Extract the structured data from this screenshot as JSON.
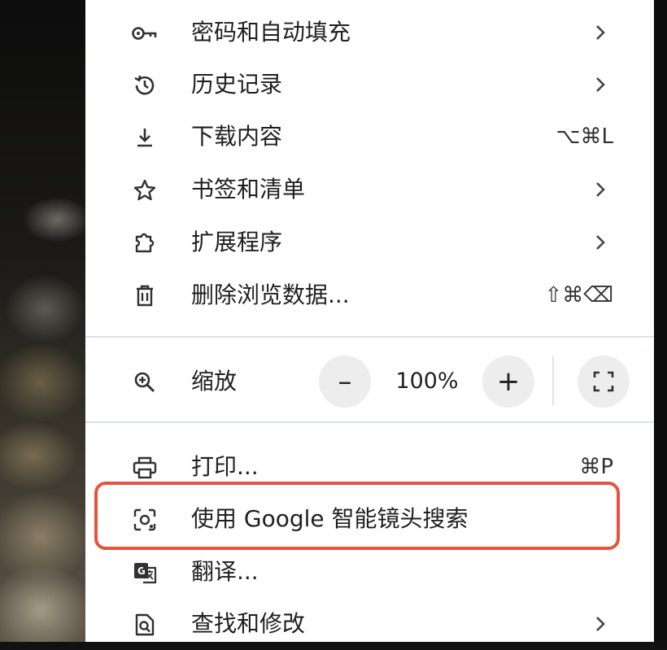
{
  "menu": {
    "items": [
      {
        "label": "密码和自动填充",
        "icon": "key-icon",
        "right": "",
        "chevron": true
      },
      {
        "label": "历史记录",
        "icon": "history-icon",
        "right": "",
        "chevron": true
      },
      {
        "label": "下载内容",
        "icon": "download-icon",
        "right": "⌥⌘L",
        "chevron": false
      },
      {
        "label": "书签和清单",
        "icon": "star-icon",
        "right": "",
        "chevron": true
      },
      {
        "label": "扩展程序",
        "icon": "puzzle-icon",
        "right": "",
        "chevron": true
      },
      {
        "label": "删除浏览数据...",
        "icon": "trash-icon",
        "right": "⇧⌘⌫",
        "chevron": false
      }
    ],
    "zoom": {
      "label": "缩放",
      "icon": "zoom-in-icon",
      "minus": "–",
      "value": "100%",
      "plus": "+",
      "fullscreen_icon": "fullscreen-icon"
    },
    "items2": [
      {
        "label": "打印...",
        "icon": "printer-icon",
        "right": "⌘P",
        "chevron": false
      },
      {
        "label": "使用 Google 智能镜头搜索",
        "icon": "google-lens-icon",
        "right": "",
        "chevron": false,
        "highlighted": true
      },
      {
        "label": "翻译...",
        "icon": "translate-icon",
        "right": "",
        "chevron": false
      },
      {
        "label": "查找和修改",
        "icon": "find-icon",
        "right": "",
        "chevron": true
      }
    ],
    "highlight_color": "#e8523e"
  }
}
